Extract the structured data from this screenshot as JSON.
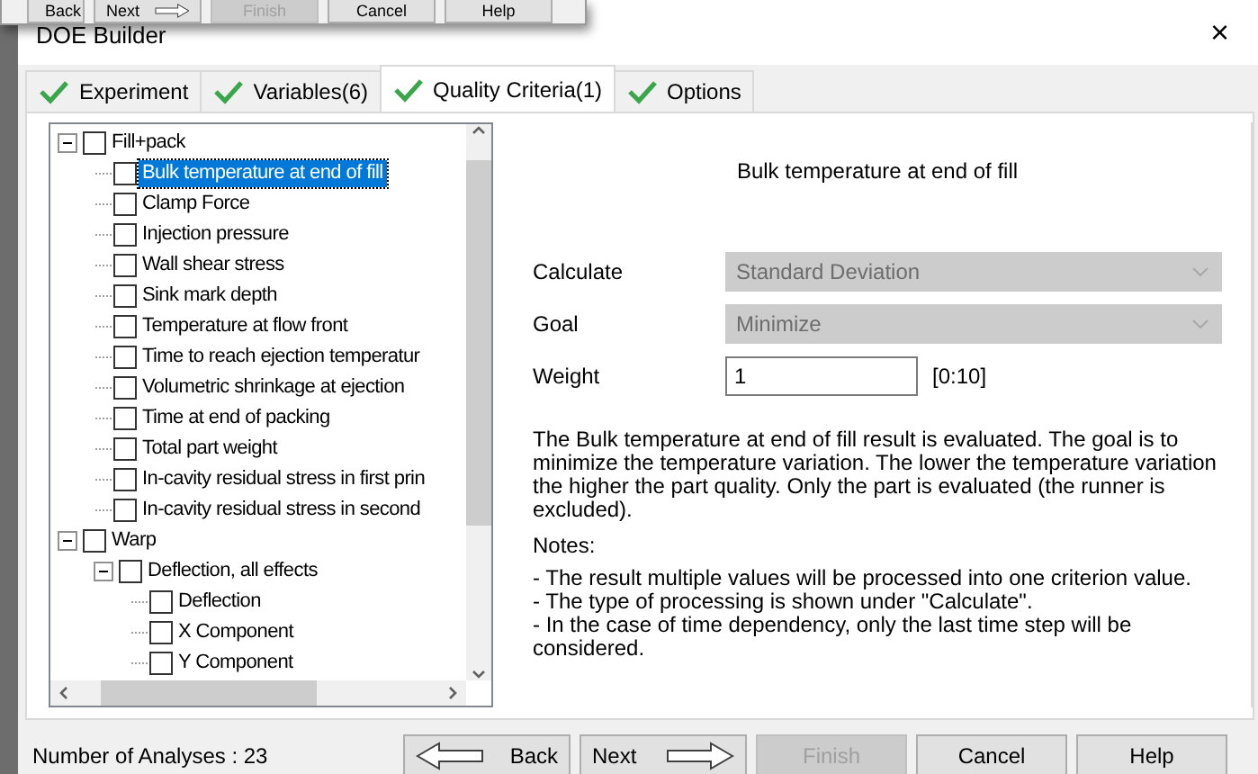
{
  "background_window": {
    "buttons": [
      {
        "label": "Back",
        "kind": "back",
        "disabled": false
      },
      {
        "label": "Next",
        "kind": "next",
        "disabled": false
      },
      {
        "label": "Finish",
        "kind": "plain",
        "disabled": true
      },
      {
        "label": "Cancel",
        "kind": "plain",
        "disabled": false
      },
      {
        "label": "Help",
        "kind": "plain",
        "disabled": false
      }
    ]
  },
  "window": {
    "title": "DOE Builder",
    "close": "×"
  },
  "tabs": [
    {
      "label": "Experiment",
      "selected": false
    },
    {
      "label": "Variables(6)",
      "selected": false
    },
    {
      "label": "Quality Criteria(1)",
      "selected": true
    },
    {
      "label": "Options",
      "selected": false
    }
  ],
  "tree": [
    {
      "label": "Fill+pack",
      "checked": false,
      "selected": false,
      "expanded": true,
      "children": [
        {
          "label": "Bulk temperature at end of fill",
          "checked": false,
          "selected": true
        },
        {
          "label": "Clamp Force",
          "checked": false,
          "selected": false
        },
        {
          "label": "Injection pressure",
          "checked": false,
          "selected": false
        },
        {
          "label": "Wall shear stress",
          "checked": false,
          "selected": false
        },
        {
          "label": "Sink mark depth",
          "checked": false,
          "selected": false
        },
        {
          "label": "Temperature at flow front",
          "checked": false,
          "selected": false
        },
        {
          "label": "Time to reach ejection temperatur",
          "checked": false,
          "selected": false
        },
        {
          "label": "Volumetric shrinkage at ejection",
          "checked": false,
          "selected": false
        },
        {
          "label": "Time at end of packing",
          "checked": false,
          "selected": false
        },
        {
          "label": "Total part weight",
          "checked": false,
          "selected": false
        },
        {
          "label": "In-cavity residual stress in first prin",
          "checked": false,
          "selected": false
        },
        {
          "label": "In-cavity residual stress in second",
          "checked": false,
          "selected": false
        }
      ]
    },
    {
      "label": "Warp",
      "checked": false,
      "selected": false,
      "expanded": true,
      "children": [
        {
          "label": "Deflection, all effects",
          "checked": false,
          "selected": false,
          "expanded": true,
          "children": [
            {
              "label": "Deflection",
              "checked": false,
              "selected": false
            },
            {
              "label": "X Component",
              "checked": false,
              "selected": false
            },
            {
              "label": "Y Component",
              "checked": false,
              "selected": false
            }
          ]
        }
      ]
    }
  ],
  "details": {
    "title": "Bulk temperature at end of fill",
    "fields": [
      {
        "kind": "dropdown",
        "label": "Calculate",
        "value": "Standard Deviation",
        "disabled": true
      },
      {
        "kind": "dropdown",
        "label": "Goal",
        "value": "Minimize",
        "disabled": true
      },
      {
        "kind": "input",
        "label": "Weight",
        "value": "1",
        "range": "[0:10]"
      }
    ],
    "description": "The Bulk temperature at end of fill result is evaluated. The goal is to minimize the temperature variation. The lower the temperature variation the higher the part quality.  Only the part is evaluated (the runner is excluded).",
    "notes_title": "Notes:",
    "notes": [
      "- The result multiple values will be processed into one criterion value.",
      "- The type of processing is shown under \"Calculate\".",
      "- In the case of time dependency, only the last time step will be considered."
    ]
  },
  "status": "Number of Analyses : 23",
  "buttons": [
    {
      "label": "Back",
      "kind": "back",
      "disabled": false
    },
    {
      "label": "Next",
      "kind": "next",
      "disabled": false
    },
    {
      "label": "Finish",
      "kind": "plain",
      "disabled": true
    },
    {
      "label": "Cancel",
      "kind": "plain",
      "disabled": false
    },
    {
      "label": "Help",
      "kind": "plain",
      "disabled": false
    }
  ]
}
